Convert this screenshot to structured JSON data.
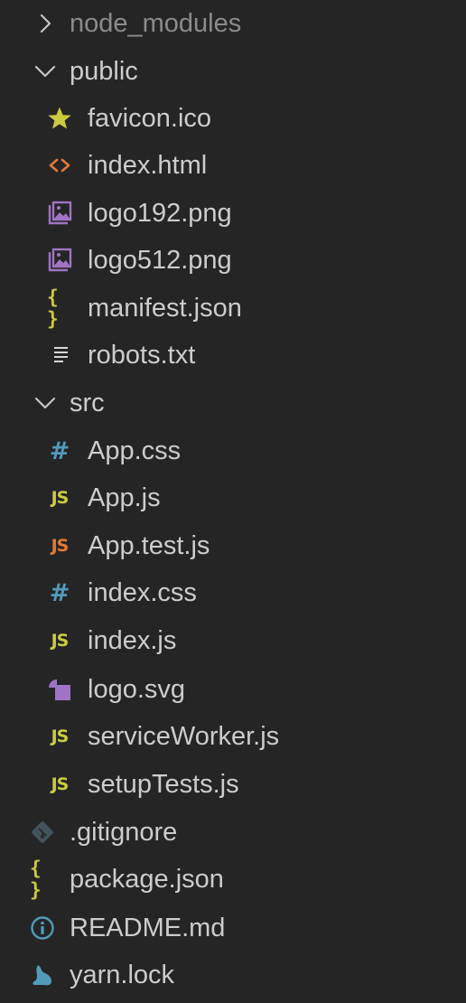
{
  "explorer": {
    "node_modules": {
      "label": "node_modules",
      "icon": "chevron-right-icon"
    },
    "public": {
      "label": "public",
      "icon": "chevron-down-icon",
      "files": {
        "favicon": {
          "label": "favicon.ico",
          "icon": "star-icon",
          "color": "#cbcb41"
        },
        "index_html": {
          "label": "index.html",
          "icon": "html-code-icon",
          "color": "#e37933"
        },
        "logo192": {
          "label": "logo192.png",
          "icon": "image-icon",
          "color": "#a074c4"
        },
        "logo512": {
          "label": "logo512.png",
          "icon": "image-icon",
          "color": "#a074c4"
        },
        "manifest": {
          "label": "manifest.json",
          "icon": "json-icon",
          "glyph": "{ }",
          "color": "#cbcb41"
        },
        "robots": {
          "label": "robots.txt",
          "icon": "text-lines-icon",
          "color": "#d4d7d6"
        }
      }
    },
    "src": {
      "label": "src",
      "icon": "chevron-down-icon",
      "files": {
        "app_css": {
          "label": "App.css",
          "icon": "css-icon",
          "glyph": "#",
          "color": "#519aba"
        },
        "app_js": {
          "label": "App.js",
          "icon": "js-icon",
          "glyph": "JS",
          "color": "#cbcb41"
        },
        "app_test": {
          "label": "App.test.js",
          "icon": "js-test-icon",
          "glyph": "JS",
          "color": "#e37933"
        },
        "index_css": {
          "label": "index.css",
          "icon": "css-icon",
          "glyph": "#",
          "color": "#519aba"
        },
        "index_js": {
          "label": "index.js",
          "icon": "js-icon",
          "glyph": "JS",
          "color": "#cbcb41"
        },
        "logo_svg": {
          "label": "logo.svg",
          "icon": "svg-shapes-icon",
          "color": "#a074c4"
        },
        "service_worker": {
          "label": "serviceWorker.js",
          "icon": "js-icon",
          "glyph": "JS",
          "color": "#cbcb41"
        },
        "setup_tests": {
          "label": "setupTests.js",
          "icon": "js-icon",
          "glyph": "JS",
          "color": "#cbcb41"
        }
      }
    },
    "root_files": {
      "gitignore": {
        "label": ".gitignore",
        "icon": "git-icon",
        "color": "#41535b"
      },
      "package_json": {
        "label": "package.json",
        "icon": "json-icon",
        "glyph": "{ }",
        "color": "#cbcb41"
      },
      "readme": {
        "label": "README.md",
        "icon": "info-icon",
        "color": "#519aba"
      },
      "yarn_lock": {
        "label": "yarn.lock",
        "icon": "yarn-icon",
        "color": "#519aba"
      }
    }
  }
}
